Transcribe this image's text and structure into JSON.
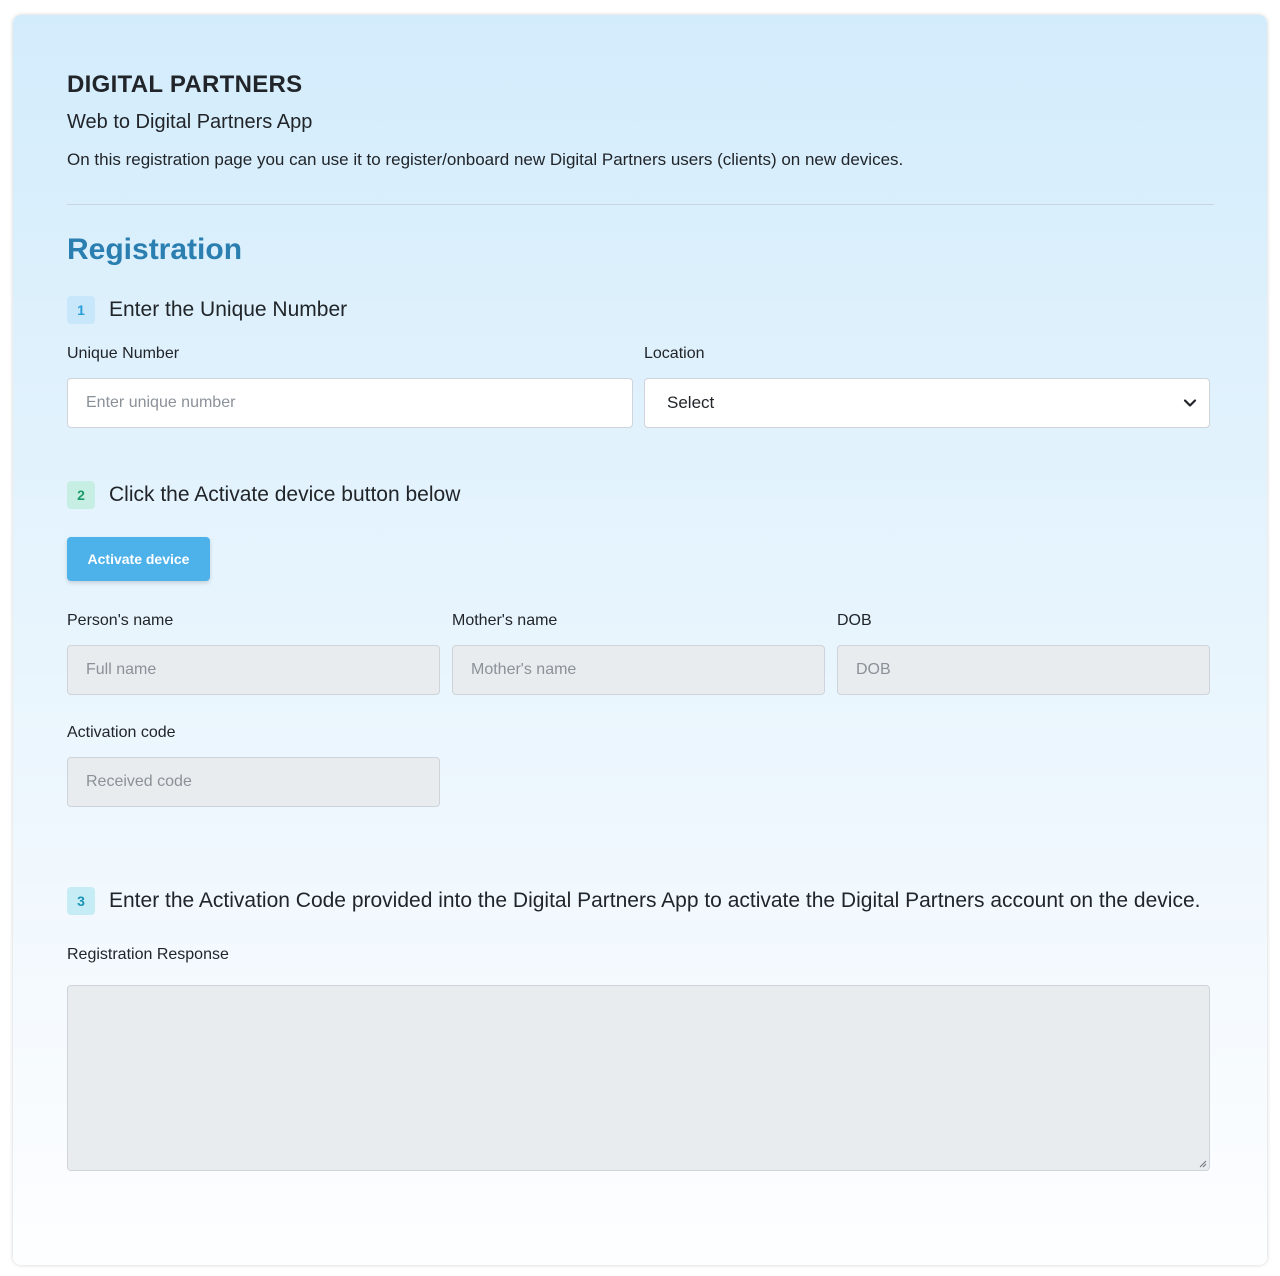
{
  "header": {
    "brand": "DIGITAL PARTNERS",
    "tagline": "Web to Digital Partners App",
    "description": "On this registration page you can use it to register/onboard new Digital Partners users (clients) on new devices."
  },
  "registration": {
    "title": "Registration",
    "step1": {
      "number": "1",
      "text": "Enter the Unique Number",
      "unique_number_label": "Unique Number",
      "unique_number_placeholder": "Enter unique number",
      "unique_number_value": "",
      "location_label": "Location",
      "location_selected": "Select"
    },
    "step2": {
      "number": "2",
      "text": "Click the Activate device button below",
      "activate_button": "Activate device",
      "person_name_label": "Person's name",
      "person_name_placeholder": "Full name",
      "mother_name_label": "Mother's name",
      "mother_name_placeholder": "Mother's name",
      "dob_label": "DOB",
      "dob_placeholder": "DOB",
      "activation_code_label": "Activation code",
      "activation_code_placeholder": "Received code"
    },
    "step3": {
      "number": "3",
      "text": "Enter the Activation Code provided into the Digital Partners App to activate the Digital Partners account on the device.",
      "response_label": "Registration Response",
      "response_value": ""
    }
  },
  "colors": {
    "accent": "#2a7fb0",
    "button": "#4db1ea",
    "disabled_field": "#e9ecef"
  }
}
